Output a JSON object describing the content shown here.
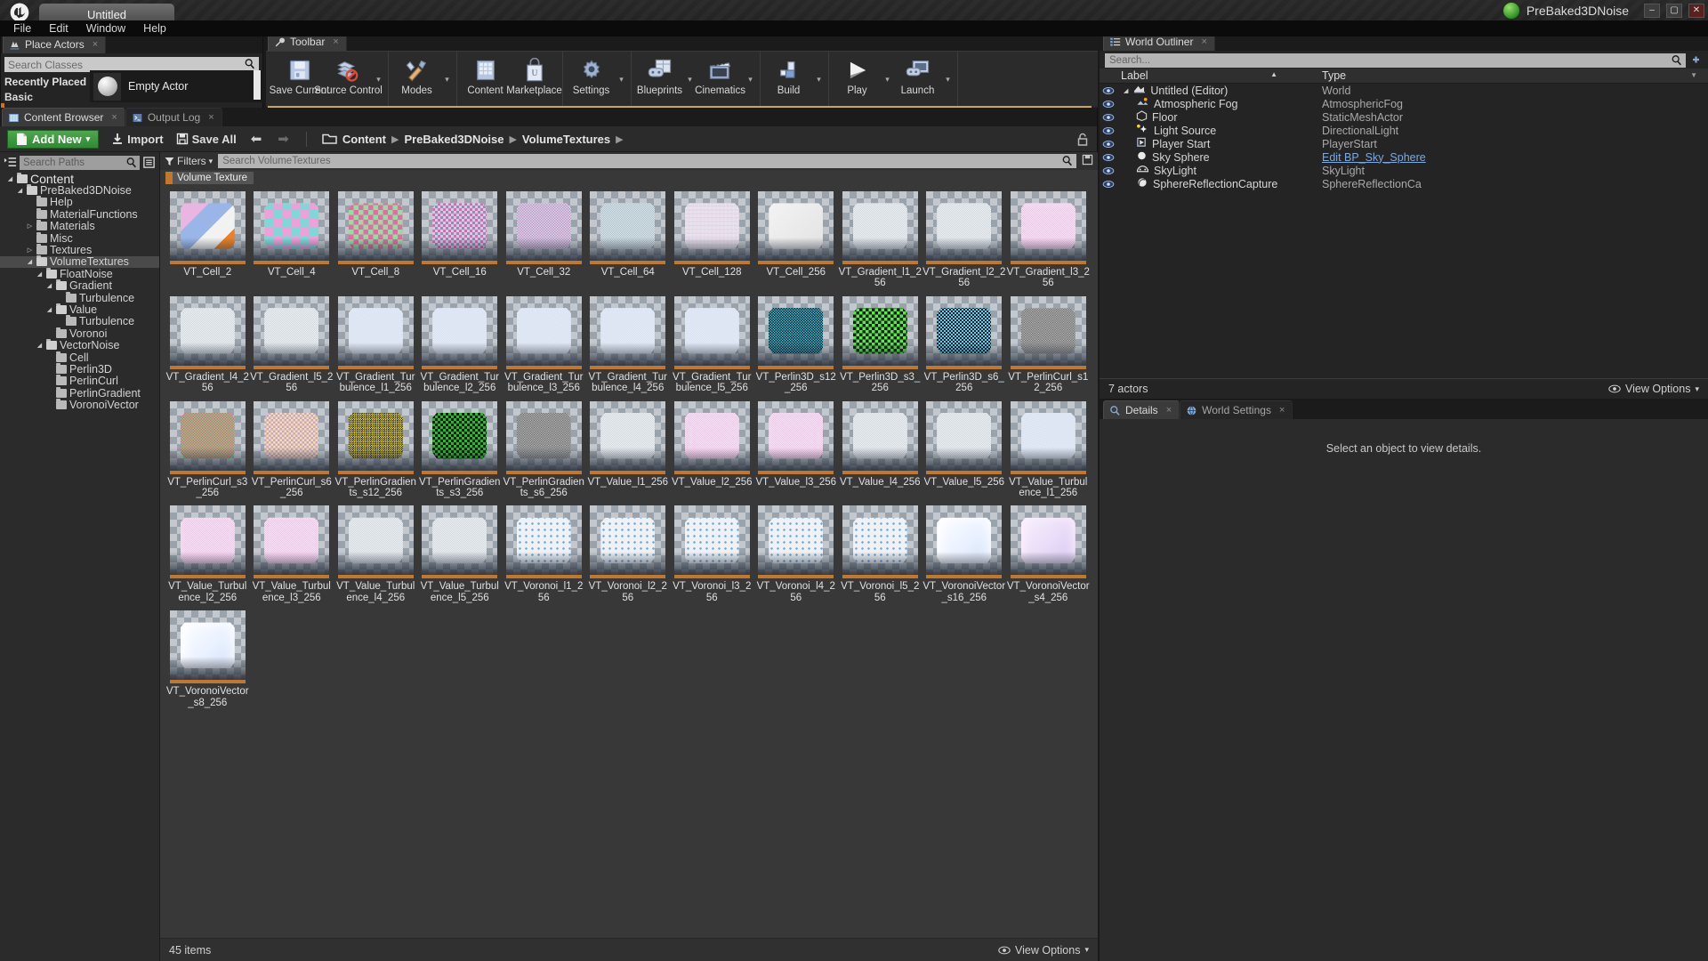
{
  "titlebar": {
    "project_tab": "Untitled",
    "project_name": "PreBaked3DNoise",
    "minimize": "–",
    "maximize": "▢",
    "close": "✕"
  },
  "menubar": {
    "items": [
      "File",
      "Edit",
      "Window",
      "Help"
    ]
  },
  "place_actors": {
    "tab": "Place Actors",
    "search_placeholder": "Search Classes",
    "categories": [
      "Recently Placed",
      "Basic"
    ],
    "item": "Empty Actor"
  },
  "toolbar": {
    "tab": "Toolbar",
    "groups": [
      {
        "buttons": [
          {
            "label": "Save Current",
            "icon": "floppy-disk-icon",
            "caret": false
          },
          {
            "label": "Source Control",
            "icon": "source-control-icon",
            "caret": true
          }
        ]
      },
      {
        "buttons": [
          {
            "label": "Modes",
            "icon": "modes-icon",
            "caret": true
          }
        ]
      },
      {
        "buttons": [
          {
            "label": "Content",
            "icon": "content-icon",
            "caret": false
          },
          {
            "label": "Marketplace",
            "icon": "marketplace-icon",
            "caret": false
          }
        ]
      },
      {
        "buttons": [
          {
            "label": "Settings",
            "icon": "gear-icon",
            "caret": true
          }
        ]
      },
      {
        "buttons": [
          {
            "label": "Blueprints",
            "icon": "blueprints-icon",
            "caret": true
          },
          {
            "label": "Cinematics",
            "icon": "cinematics-icon",
            "caret": true
          }
        ]
      },
      {
        "buttons": [
          {
            "label": "Build",
            "icon": "build-icon",
            "caret": true
          }
        ]
      },
      {
        "buttons": [
          {
            "label": "Play",
            "icon": "play-icon",
            "caret": true
          },
          {
            "label": "Launch",
            "icon": "launch-icon",
            "caret": true
          }
        ]
      }
    ]
  },
  "content_browser": {
    "tabs": [
      {
        "label": "Content Browser",
        "icon": "content-browser-icon",
        "active": true
      },
      {
        "label": "Output Log",
        "icon": "output-log-icon",
        "active": false
      }
    ],
    "add_new": "Add New",
    "import": "Import",
    "save_all": "Save All",
    "breadcrumb": [
      "Content",
      "PreBaked3DNoise",
      "VolumeTextures"
    ],
    "paths_search_placeholder": "Search Paths",
    "filters_label": "Filters",
    "asset_search_placeholder": "Search VolumeTextures",
    "filter_chip": "Volume Texture",
    "filter_chip_color": "#c2772a",
    "item_count": "45 items",
    "view_options": "View Options",
    "tree": [
      {
        "label": "Content",
        "depth": 0,
        "arrow": "down",
        "selected": false,
        "root": true
      },
      {
        "label": "PreBaked3DNoise",
        "depth": 1,
        "arrow": "down",
        "selected": false
      },
      {
        "label": "Help",
        "depth": 2,
        "arrow": "none",
        "selected": false
      },
      {
        "label": "MaterialFunctions",
        "depth": 2,
        "arrow": "none",
        "selected": false
      },
      {
        "label": "Materials",
        "depth": 2,
        "arrow": "right",
        "selected": false
      },
      {
        "label": "Misc",
        "depth": 2,
        "arrow": "none",
        "selected": false
      },
      {
        "label": "Textures",
        "depth": 2,
        "arrow": "right",
        "selected": false
      },
      {
        "label": "VolumeTextures",
        "depth": 2,
        "arrow": "down",
        "selected": true
      },
      {
        "label": "FloatNoise",
        "depth": 3,
        "arrow": "down",
        "selected": false
      },
      {
        "label": "Gradient",
        "depth": 4,
        "arrow": "down",
        "selected": false
      },
      {
        "label": "Turbulence",
        "depth": 5,
        "arrow": "none",
        "selected": false
      },
      {
        "label": "Value",
        "depth": 4,
        "arrow": "down",
        "selected": false
      },
      {
        "label": "Turbulence",
        "depth": 5,
        "arrow": "none",
        "selected": false
      },
      {
        "label": "Voronoi",
        "depth": 4,
        "arrow": "none",
        "selected": false
      },
      {
        "label": "VectorNoise",
        "depth": 3,
        "arrow": "down",
        "selected": false
      },
      {
        "label": "Cell",
        "depth": 4,
        "arrow": "none",
        "selected": false
      },
      {
        "label": "Perlin3D",
        "depth": 4,
        "arrow": "none",
        "selected": false
      },
      {
        "label": "PerlinCurl",
        "depth": 4,
        "arrow": "none",
        "selected": false
      },
      {
        "label": "PerlinGradient",
        "depth": 4,
        "arrow": "none",
        "selected": false
      },
      {
        "label": "VoronoiVector",
        "depth": 4,
        "arrow": "none",
        "selected": false
      }
    ],
    "assets": [
      {
        "name": "VT_Cell_2",
        "style": "cell2"
      },
      {
        "name": "VT_Cell_4",
        "style": "cell4"
      },
      {
        "name": "VT_Cell_8",
        "style": "cell8"
      },
      {
        "name": "VT_Cell_16",
        "style": "cell16"
      },
      {
        "name": "VT_Cell_32",
        "style": "cell32"
      },
      {
        "name": "VT_Cell_64",
        "style": "cell64"
      },
      {
        "name": "VT_Cell_128",
        "style": "cell128"
      },
      {
        "name": "VT_Cell_256",
        "style": "flatwhite"
      },
      {
        "name": "VT_Gradient_l1_256",
        "style": "pale"
      },
      {
        "name": "VT_Gradient_l2_256",
        "style": "pale"
      },
      {
        "name": "VT_Gradient_l3_256",
        "style": "pale"
      },
      {
        "name": "VT_Gradient_l4_256",
        "style": "pale"
      },
      {
        "name": "VT_Gradient_l5_256",
        "style": "pale"
      },
      {
        "name": "VT_Gradient_Turbulence_l1_256",
        "style": "paleblue"
      },
      {
        "name": "VT_Gradient_Turbulence_l2_256",
        "style": "paleblue"
      },
      {
        "name": "VT_Gradient_Turbulence_l3_256",
        "style": "paleblue"
      },
      {
        "name": "VT_Gradient_Turbulence_l4_256",
        "style": "paleblue"
      },
      {
        "name": "VT_Gradient_Turbulence_l5_256",
        "style": "paleblue"
      },
      {
        "name": "VT_Perlin3D_s12_256",
        "style": "darkrgb"
      },
      {
        "name": "VT_Perlin3D_s3_256",
        "style": "neonrgb"
      },
      {
        "name": "VT_Perlin3D_s6_256",
        "style": "neonrgb2"
      },
      {
        "name": "VT_PerlinCurl_s12_256",
        "style": "fineRGB"
      },
      {
        "name": "VT_PerlinCurl_s3_256",
        "style": "pinkgreen"
      },
      {
        "name": "VT_PerlinCurl_s6_256",
        "style": "pastelcurl"
      },
      {
        "name": "VT_PerlinGradients_s12_256",
        "style": "yellowblack"
      },
      {
        "name": "VT_PerlinGradients_s3_256",
        "style": "boldrgb"
      },
      {
        "name": "VT_PerlinGradients_s6_256",
        "style": "fineRGB"
      },
      {
        "name": "VT_Value_l1_256",
        "style": "pale"
      },
      {
        "name": "VT_Value_l2_256",
        "style": "pale"
      },
      {
        "name": "VT_Value_l3_256",
        "style": "pale"
      },
      {
        "name": "VT_Value_l4_256",
        "style": "pale"
      },
      {
        "name": "VT_Value_l5_256",
        "style": "pale"
      },
      {
        "name": "VT_Value_Turbulence_l1_256",
        "style": "paleblue"
      },
      {
        "name": "VT_Value_Turbulence_l2_256",
        "style": "pale"
      },
      {
        "name": "VT_Value_Turbulence_l3_256",
        "style": "pale"
      },
      {
        "name": "VT_Value_Turbulence_l4_256",
        "style": "pale"
      },
      {
        "name": "VT_Value_Turbulence_l5_256",
        "style": "pale"
      },
      {
        "name": "VT_Voronoi_l1_256",
        "style": "dots"
      },
      {
        "name": "VT_Voronoi_l2_256",
        "style": "dots"
      },
      {
        "name": "VT_Voronoi_l3_256",
        "style": "dots"
      },
      {
        "name": "VT_Voronoi_l4_256",
        "style": "dots"
      },
      {
        "name": "VT_Voronoi_l5_256",
        "style": "dots"
      },
      {
        "name": "VT_VoronoiVector_s16_256",
        "style": "glow"
      },
      {
        "name": "VT_VoronoiVector_s4_256",
        "style": "glowpink"
      },
      {
        "name": "VT_VoronoiVector_s8_256",
        "style": "glow"
      }
    ]
  },
  "world_outliner": {
    "tab": "World Outliner",
    "search_placeholder": "Search...",
    "columns": {
      "label": "Label",
      "type": "Type"
    },
    "rows": [
      {
        "label": "Untitled (Editor)",
        "type": "World",
        "depth": 0,
        "icon": "world-icon",
        "arrow": "down",
        "link": false
      },
      {
        "label": "Atmospheric Fog",
        "type": "AtmosphericFog",
        "depth": 1,
        "icon": "fog-icon",
        "arrow": "none",
        "link": false
      },
      {
        "label": "Floor",
        "type": "StaticMeshActor",
        "depth": 1,
        "icon": "mesh-icon",
        "arrow": "none",
        "link": false
      },
      {
        "label": "Light Source",
        "type": "DirectionalLight",
        "depth": 1,
        "icon": "light-icon",
        "arrow": "none",
        "link": false
      },
      {
        "label": "Player Start",
        "type": "PlayerStart",
        "depth": 1,
        "icon": "playerstart-icon",
        "arrow": "none",
        "link": false
      },
      {
        "label": "Sky Sphere",
        "type": "Edit BP_Sky_Sphere",
        "depth": 1,
        "icon": "sphere-icon",
        "arrow": "none",
        "link": true
      },
      {
        "label": "SkyLight",
        "type": "SkyLight",
        "depth": 1,
        "icon": "skylight-icon",
        "arrow": "none",
        "link": false
      },
      {
        "label": "SphereReflectionCapture",
        "type": "SphereReflectionCa",
        "depth": 1,
        "icon": "reflection-icon",
        "arrow": "none",
        "link": false
      }
    ],
    "actor_count": "7 actors",
    "view_options": "View Options"
  },
  "details": {
    "tabs": [
      {
        "label": "Details",
        "icon": "details-icon",
        "active": true
      },
      {
        "label": "World Settings",
        "icon": "world-settings-icon",
        "active": false
      }
    ],
    "empty_message": "Select an object to view details."
  }
}
